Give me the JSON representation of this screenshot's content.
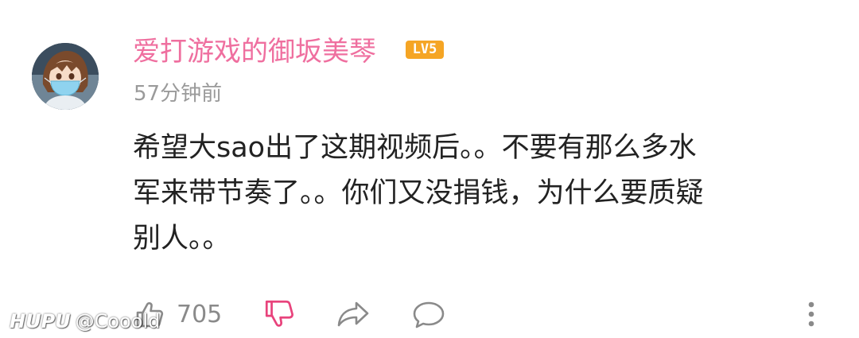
{
  "comment": {
    "username": "爱打游戏的御坂美琴",
    "level": "LV5",
    "timestamp": "57分钟前",
    "text_lines": [
      "希望大sao出了这期视频后。。不要有那么多水",
      "军来带节奏了。。你们又没捐钱，为什么要质疑",
      "别人。。"
    ]
  },
  "actions": {
    "like_count": "705"
  },
  "watermark": {
    "brand": "HUPU",
    "handle": "@Cooold"
  },
  "colors": {
    "username": "#ef6f9f",
    "level_badge": "#f5a524",
    "dislike_active": "#e8437c",
    "icon_gray": "#8a8a8a"
  },
  "icons": [
    "thumbs-up-icon",
    "thumbs-down-icon",
    "share-icon",
    "reply-icon",
    "more-vertical-icon"
  ]
}
